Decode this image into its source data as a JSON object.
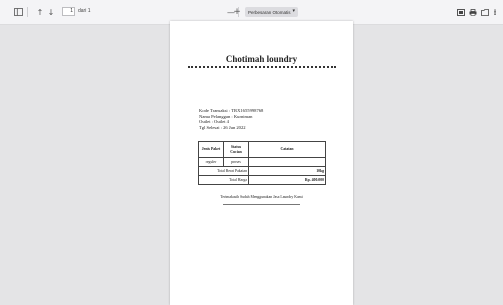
{
  "toolbar": {
    "page_number": "1",
    "page_of": "dari 1",
    "zoom_minus": "—",
    "zoom_plus": "+",
    "zoom_level": "Perbesaran Otomatis",
    "icons": [
      "sidebar-toggle-icon",
      "arrow-up-icon",
      "arrow-down-icon",
      "zoom-out-icon",
      "zoom-in-icon",
      "open-file-icon",
      "print-icon",
      "save-icon",
      "more-icon"
    ]
  },
  "receipt": {
    "shop_name": "Chotimah loundry",
    "kode_transaksi": "Kode Transaksi : TRX1655998768",
    "nama_pelanggan": "Nama Pelanggan : Kurniman",
    "outlet": "Outlet : Outlet 4",
    "tgl_selesai": "Tgl Selesai : 26 Jun 2022",
    "table": {
      "headers": [
        "Jenis Paket",
        "Status Cucian",
        "Catatan"
      ],
      "row": [
        "reguler",
        "proses",
        ""
      ],
      "total_berat_label": "Total Berat Pakaian",
      "total_berat_value": "10kg",
      "total_harga_label": "Total Harga",
      "total_harga_value": "Rp. 400.000"
    },
    "thanks": "Terimakasih Sudah Menggunakan Jasa Laundry Kami"
  }
}
